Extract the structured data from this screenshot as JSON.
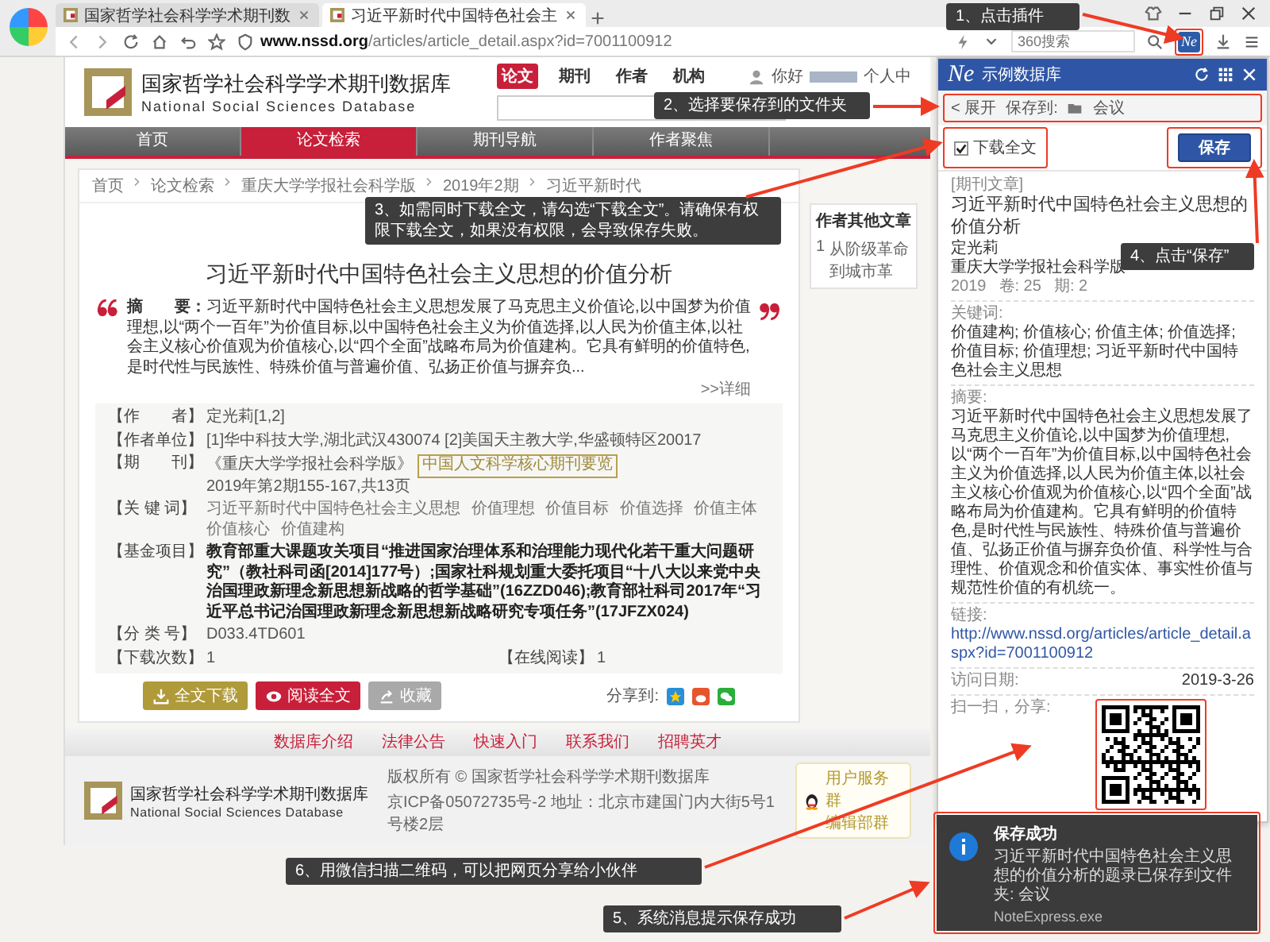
{
  "browser": {
    "tabs": [
      {
        "title": "国家哲学社会科学学术期刊数",
        "selected": false
      },
      {
        "title": "习近平新时代中国特色社会主",
        "selected": true
      }
    ],
    "url_host": "www.nssd.org",
    "url_path": "/articles/article_detail.aspx?id=7001100912",
    "search_placeholder": "360搜索",
    "plugin_label": "Ne"
  },
  "site": {
    "logo_cn": "国家哲学社会科学学术期刊数据库",
    "logo_en": "National Social Sciences Database",
    "search_tabs": [
      {
        "label": "论文",
        "selected": true
      },
      {
        "label": "期刊",
        "selected": false
      },
      {
        "label": "作者",
        "selected": false
      },
      {
        "label": "机构",
        "selected": false
      }
    ],
    "greeting": "你好",
    "user_center": "个人中",
    "nav": [
      {
        "label": "首页",
        "selected": false
      },
      {
        "label": "论文检索",
        "selected": true
      },
      {
        "label": "期刊导航",
        "selected": false
      },
      {
        "label": "作者聚焦",
        "selected": false
      }
    ],
    "breadcrumb": [
      "首页",
      "论文检索",
      "重庆大学学报社会科学版",
      "2019年2期",
      "习近平新时代"
    ],
    "sidebar": {
      "title": "作者其他文章",
      "items": [
        {
          "index": "1",
          "title": "从阶级革命到城市革"
        }
      ]
    },
    "article": {
      "title": "习近平新时代中国特色社会主义思想的价值分析",
      "abstract_label": "摘　　要：",
      "abstract": "习近平新时代中国特色社会主义思想发展了马克思主义价值论,以中国梦为价值理想,以“两个一百年”为价值目标,以中国特色社会主义为价值选择,以人民为价值主体,以社会主义核心价值观为价值核心,以“四个全面”战略布局为价值建构。它具有鲜明的价值特色,是时代性与民族性、特殊价值与普遍价值、弘扬正价值与摒弃负...",
      "more": ">>详细",
      "meta": [
        {
          "kind": "text",
          "label": "【作　　者】",
          "value": "定光莉[1,2]"
        },
        {
          "kind": "text",
          "label": "【作者单位】",
          "value": "[1]华中科技大学,湖北武汉430074 [2]美国天主教大学,华盛顿特区20017"
        },
        {
          "kind": "journal",
          "label": "【期　　刊】",
          "value": "《重庆大学学报社会科学版》",
          "badge": "中国人文科学核心期刊要览",
          "extra": "2019年第2期155-167,共13页"
        },
        {
          "kind": "keywords",
          "label": "【关 键 词】",
          "keywords": [
            "习近平新时代中国特色社会主义思想",
            "价值理想",
            "价值目标",
            "价值选择",
            "价值主体",
            "价值核心",
            "价值建构"
          ]
        },
        {
          "kind": "text",
          "label": "【基金项目】",
          "value": "教育部重大课题攻关项目“推进国家治理体系和治理能力现代化若干重大问题研究”（教社科司函[2014]177号）;国家社科规划重大委托项目“十八大以来党中央治国理政新理念新思想新战略的哲学基础”(16ZZD046);教育部社科司2017年“习近平总书记治国理政新理念新思想新战略研究专项任务”(17JFZX024)",
          "bold": true
        },
        {
          "kind": "text",
          "label": "【分 类 号】",
          "value": "D033.4TD601"
        },
        {
          "kind": "pair",
          "label": "【下载次数】",
          "value": "1",
          "label2": "【在线阅读】",
          "value2": "1"
        }
      ]
    },
    "actions": [
      {
        "kind": "download",
        "label": "全文下载"
      },
      {
        "kind": "read",
        "label": "阅读全文"
      },
      {
        "kind": "favorite",
        "label": "收藏"
      }
    ],
    "share_label": "分享到:",
    "footer_links": [
      "数据库介绍",
      "法律公告",
      "快速入门",
      "联系我们",
      "招聘英才"
    ],
    "footer_logo_cn": "国家哲学社会科学学术期刊数据库",
    "footer_logo_en": "National Social Sciences Database",
    "copyright": "版权所有 © 国家哲学社会科学学术期刊数据库",
    "icp": "京ICP备05072735号-2 地址：北京市建国门内大街5号1号楼2层",
    "qq_groups": [
      "用户服务群",
      "编辑部群"
    ]
  },
  "plugin": {
    "logo": "Ne",
    "title": "示例数据库",
    "expand": "< 展开",
    "save_to_label": "保存到:",
    "folder": "会议",
    "download_fulltext": {
      "label": "下载全文",
      "checked": true
    },
    "save_button": "保存",
    "record": {
      "type": "[期刊文章]",
      "title": "习近平新时代中国特色社会主义思想的价值分析",
      "author": "定光莉",
      "journal": "重庆大学学报社会科学版",
      "year": "2019",
      "volume": "卷: 25",
      "issue": "期: 2",
      "keywords_label": "关键词:",
      "keywords": "价值建构; 价值核心; 价值主体; 价值选择; 价值目标; 价值理想; 习近平新时代中国特色社会主义思想",
      "abstract_label": "摘要:",
      "abstract": "习近平新时代中国特色社会主义思想发展了马克思主义价值论,以中国梦为价值理想,以“两个一百年”为价值目标,以中国特色社会主义为价值选择,以人民为价值主体,以社会主义核心价值观为价值核心,以“四个全面”战略布局为价值建构。它具有鲜明的价值特色,是时代性与民族性、特殊价值与普遍价值、弘扬正价值与摒弃负价值、科学性与合理性、价值观念和价值实体、事实性价值与规范性价值的有机统一。",
      "link_label": "链接:",
      "link": "http://www.nssd.org/articles/article_detail.aspx?id=7001100912",
      "date_label": "访问日期:",
      "date": "2019-3-26",
      "share_label": "扫一扫，分享:"
    }
  },
  "notification": {
    "title": "保存成功",
    "message": "习近平新时代中国特色社会主义思想的价值分析的题录已保存到文件夹: 会议",
    "source": "NoteExpress.exe"
  },
  "callouts": [
    {
      "text": "1、点击插件"
    },
    {
      "text": "2、选择要保存到的文件夹"
    },
    {
      "text": "3、如需同时下载全文，请勾选“下载全文”。请确保有权限下载全文，如果没有权限，会导致保存失败。"
    },
    {
      "text": "4、点击“保存”"
    },
    {
      "text": "5、系统消息提示保存成功"
    },
    {
      "text": "6、用微信扫描二维码，可以把网页分享给小伙伴"
    }
  ]
}
